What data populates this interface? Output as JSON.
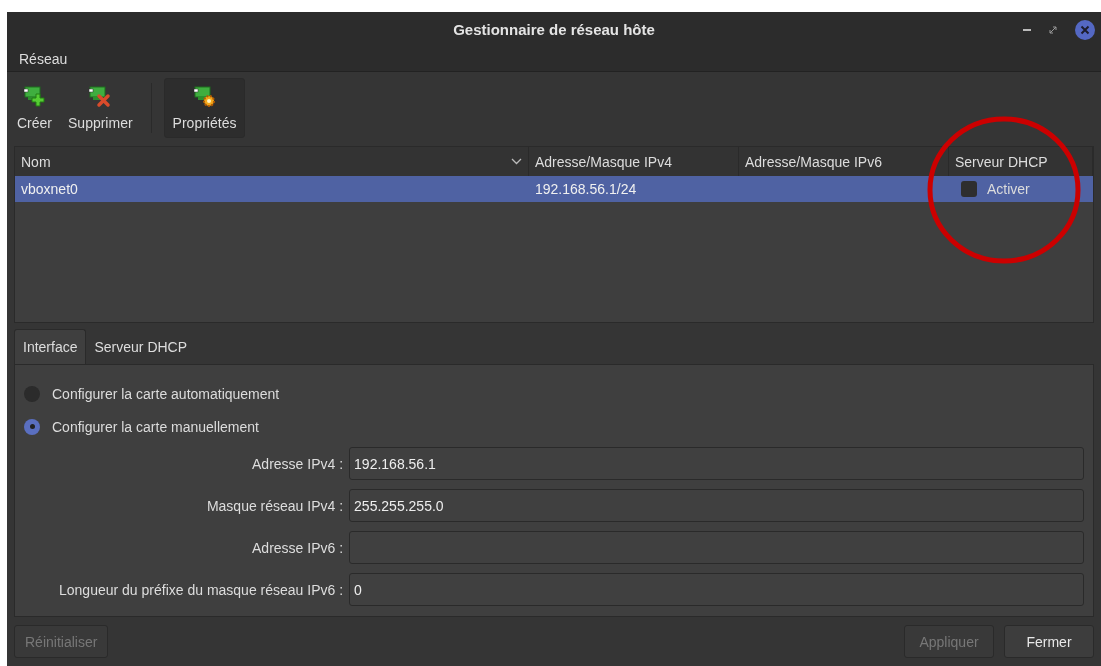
{
  "window": {
    "title": "Gestionnaire de réseau hôte"
  },
  "menu": [
    {
      "label": "Réseau"
    }
  ],
  "toolbar": [
    {
      "label": "Créer",
      "kind": "create",
      "pressed": false
    },
    {
      "label": "Supprimer",
      "kind": "delete",
      "pressed": false
    },
    {
      "label": "Propriétés",
      "kind": "properties",
      "pressed": true
    }
  ],
  "table": {
    "columns": [
      {
        "label": "Nom",
        "sorted": true
      },
      {
        "label": "Adresse/Masque IPv4",
        "sorted": false
      },
      {
        "label": "Adresse/Masque IPv6",
        "sorted": false
      },
      {
        "label": "Serveur DHCP",
        "sorted": false
      }
    ],
    "rows": [
      {
        "name": "vboxnet0",
        "ipv4": "192.168.56.1/24",
        "dhcp_label": "Activer",
        "dhcp_checked": false,
        "selected": true
      }
    ]
  },
  "annotation": {
    "kind": "circle"
  },
  "tabs": [
    {
      "label": "Interface",
      "selected": true
    },
    {
      "label": "Serveur DHCP",
      "selected": false
    }
  ],
  "radios": [
    {
      "label": "Configurer la carte automatiquement",
      "selected": false
    },
    {
      "label": "Configurer la carte manuellement",
      "selected": true
    }
  ],
  "fields": [
    {
      "label": "Adresse IPv4 :",
      "value": "192.168.56.1"
    },
    {
      "label": "Masque réseau IPv4 :",
      "value": "255.255.255.0"
    },
    {
      "label": "Adresse IPv6 :"
    },
    {
      "label": "Longueur du préfixe du masque réseau IPv6 :",
      "value": "0"
    }
  ],
  "left_buttons": [
    {
      "label": "Réinitialiser",
      "disabled": true
    }
  ],
  "right_buttons": [
    {
      "label": "Appliquer",
      "disabled": true
    },
    {
      "label": "Fermer",
      "disabled": false
    }
  ]
}
